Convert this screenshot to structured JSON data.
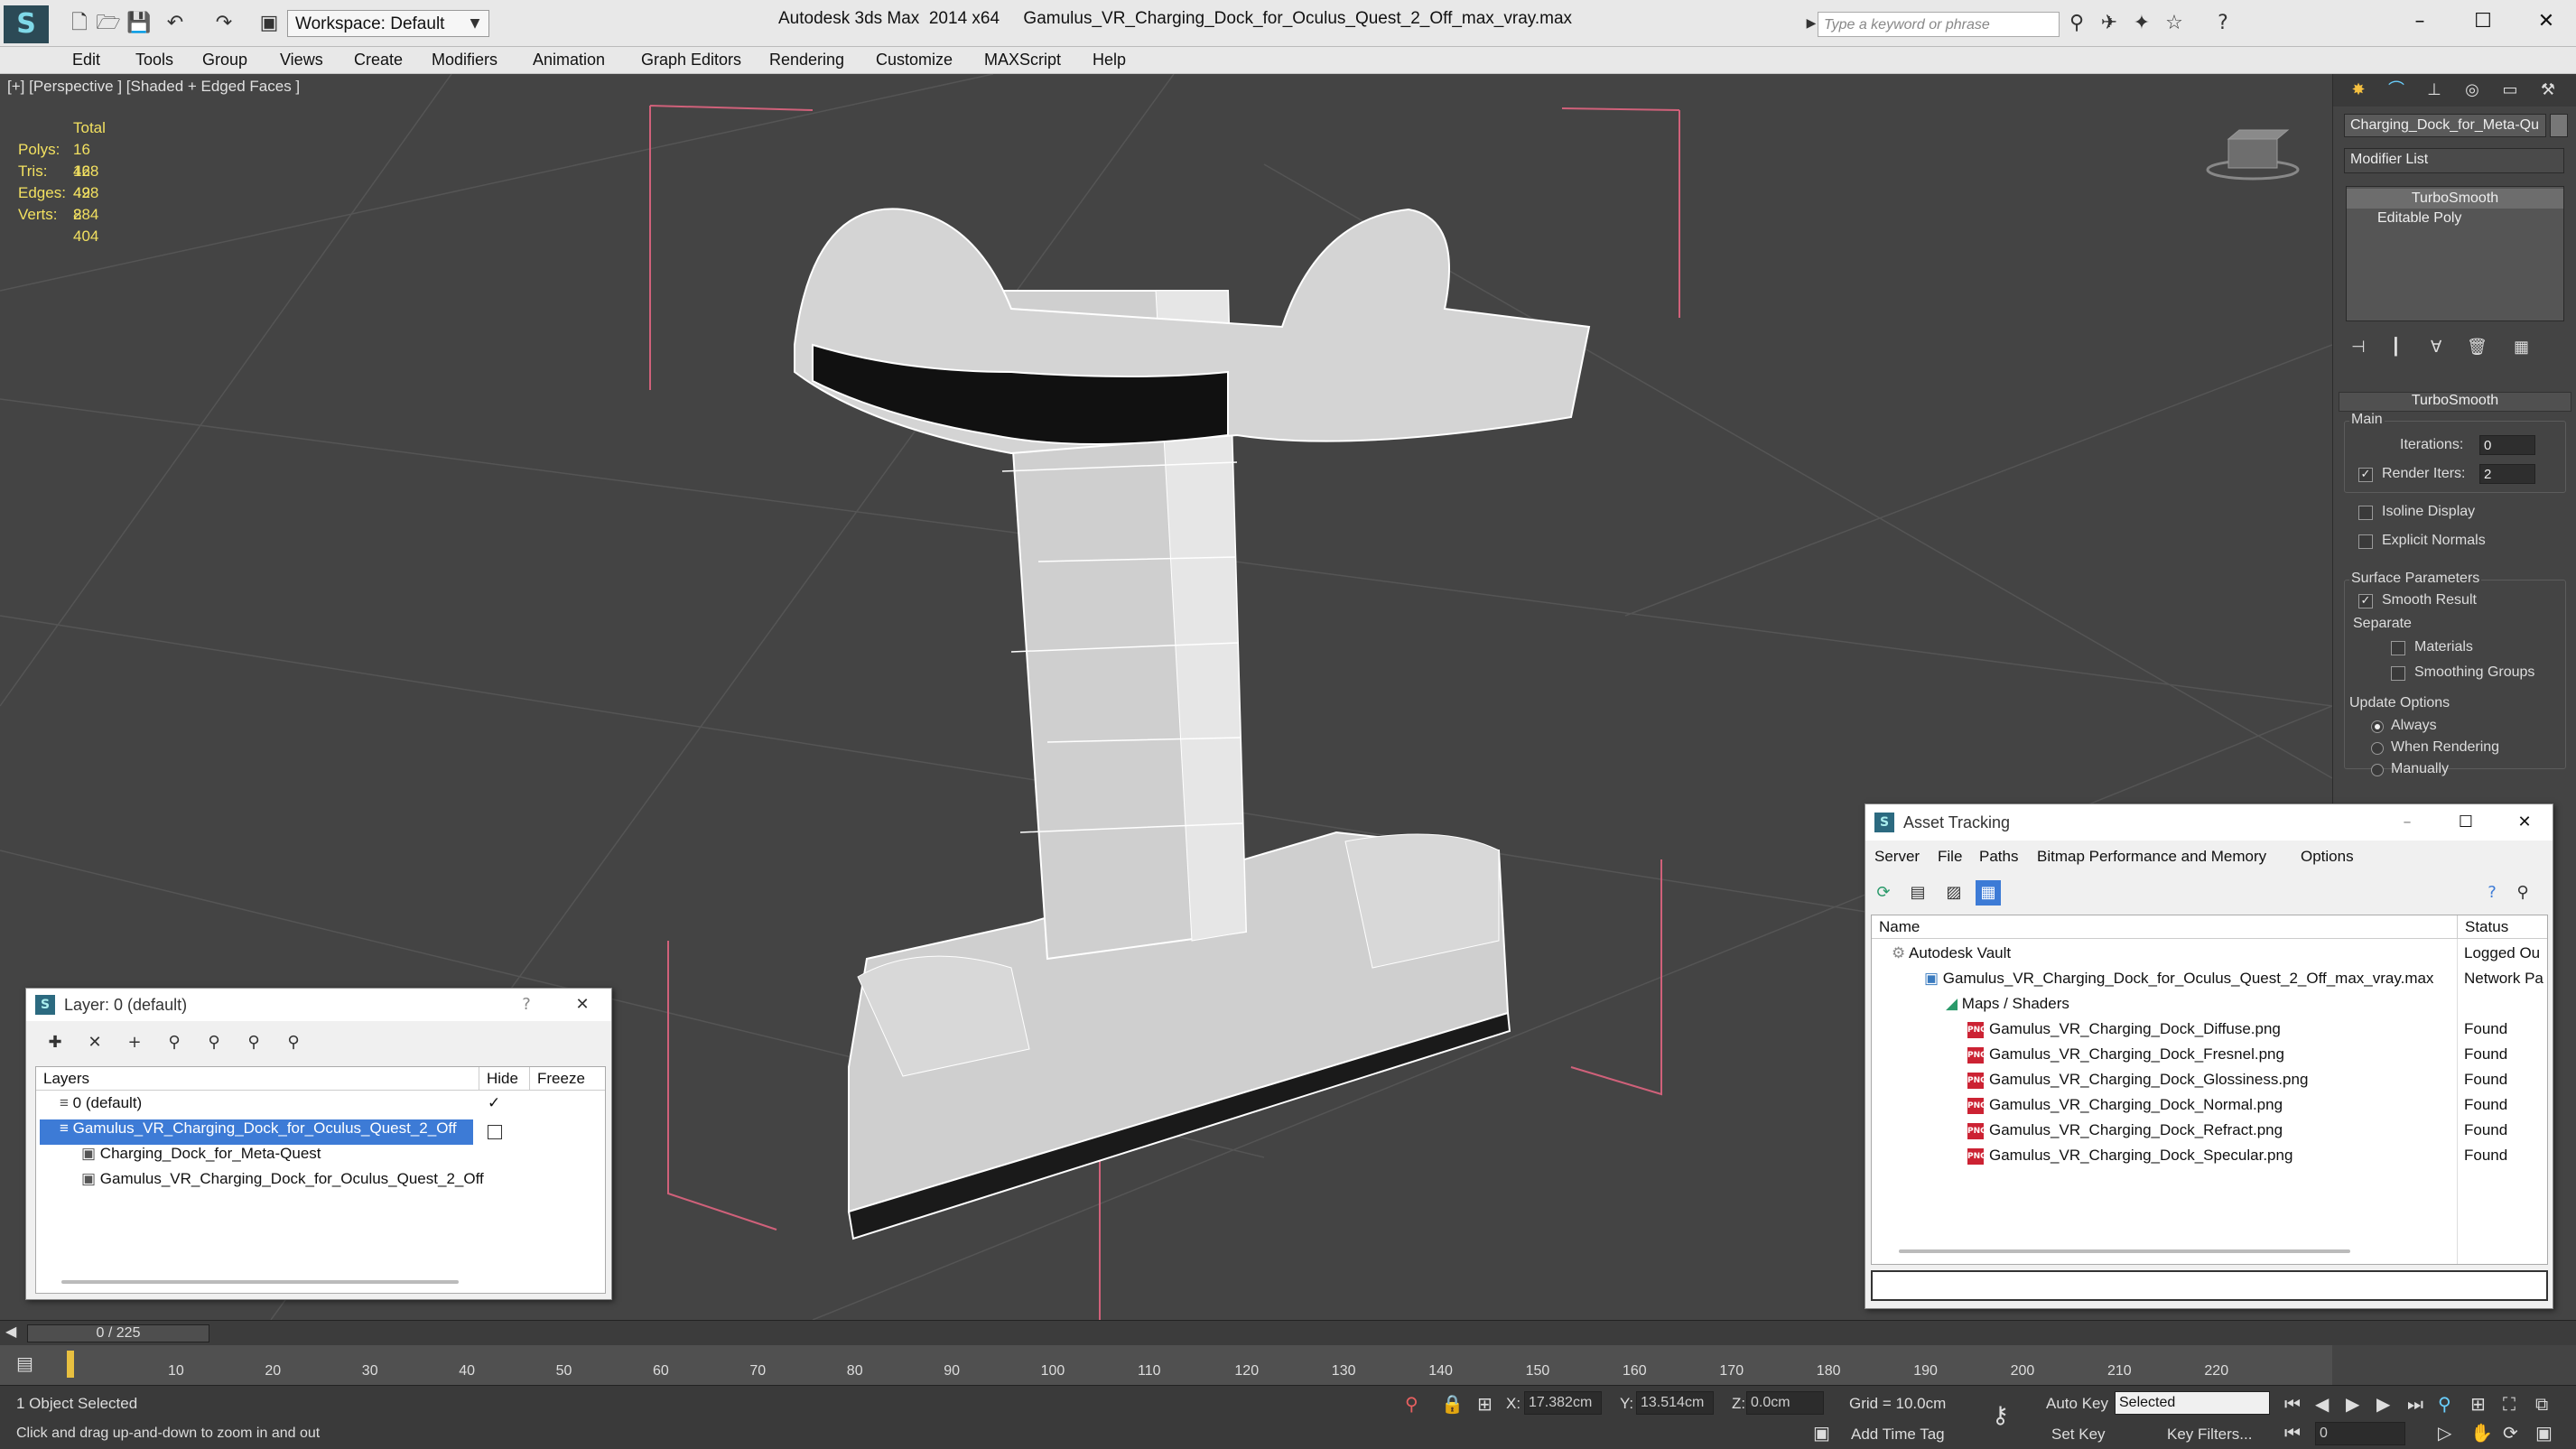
{
  "app": {
    "title": "Autodesk 3ds Max  2014 x64     Gamulus_VR_Charging_Dock_for_Oculus_Quest_2_Off_max_vray.max",
    "workspace": "Workspace: Default",
    "search_placeholder": "Type a keyword or phrase"
  },
  "menu": [
    "Edit",
    "Tools",
    "Group",
    "Views",
    "Create",
    "Modifiers",
    "Animation",
    "Graph Editors",
    "Rendering",
    "Customize",
    "MAXScript",
    "Help"
  ],
  "viewport": {
    "label": "[+] [Perspective ] [Shaded + Edged Faces ]",
    "stats": {
      "header": "Total",
      "rows": [
        {
          "k": "Polys:",
          "v": "16 428"
        },
        {
          "k": "Tris:",
          "v": "16 428"
        },
        {
          "k": "Edges:",
          "v": "49 284"
        },
        {
          "k": "Verts:",
          "v": "8 404"
        }
      ]
    }
  },
  "command_panel": {
    "object_name": "Charging_Dock_for_Meta-Qu",
    "modifier_list": "Modifier List",
    "stack": [
      "TurboSmooth",
      "Editable Poly"
    ],
    "rollout_title": "TurboSmooth",
    "main_label": "Main",
    "iterations_label": "Iterations:",
    "iterations_value": "0",
    "render_iters_label": "Render Iters:",
    "render_iters_value": "2",
    "isoline_display": "Isoline Display",
    "explicit_normals": "Explicit Normals",
    "surface_parameters": "Surface Parameters",
    "smooth_result": "Smooth Result",
    "separate": "Separate",
    "materials": "Materials",
    "smoothing_groups": "Smoothing Groups",
    "update_options": "Update Options",
    "always": "Always",
    "when_rendering": "When Rendering",
    "manually": "Manually"
  },
  "asset_tracking": {
    "title": "Asset Tracking",
    "menu": [
      "Server",
      "File",
      "Paths",
      "Bitmap Performance and Memory",
      "Options"
    ],
    "col_name": "Name",
    "col_status": "Status",
    "rows": [
      {
        "name": "Autodesk Vault",
        "status": "Logged Ou"
      },
      {
        "name": "Gamulus_VR_Charging_Dock_for_Oculus_Quest_2_Off_max_vray.max",
        "status": "Network Pa"
      },
      {
        "name": "Maps / Shaders",
        "status": ""
      },
      {
        "name": "Gamulus_VR_Charging_Dock_Diffuse.png",
        "status": "Found"
      },
      {
        "name": "Gamulus_VR_Charging_Dock_Fresnel.png",
        "status": "Found"
      },
      {
        "name": "Gamulus_VR_Charging_Dock_Glossiness.png",
        "status": "Found"
      },
      {
        "name": "Gamulus_VR_Charging_Dock_Normal.png",
        "status": "Found"
      },
      {
        "name": "Gamulus_VR_Charging_Dock_Refract.png",
        "status": "Found"
      },
      {
        "name": "Gamulus_VR_Charging_Dock_Specular.png",
        "status": "Found"
      }
    ]
  },
  "layer_dialog": {
    "title": "Layer: 0 (default)",
    "help": "?",
    "col_layers": "Layers",
    "col_hide": "Hide",
    "col_freeze": "Freeze",
    "rows": [
      {
        "name": "0 (default)"
      },
      {
        "name": "Gamulus_VR_Charging_Dock_for_Oculus_Quest_2_Off"
      },
      {
        "name": "Charging_Dock_for_Meta-Quest"
      },
      {
        "name": "Gamulus_VR_Charging_Dock_for_Oculus_Quest_2_Off"
      }
    ]
  },
  "timeline": {
    "slider": "0 / 225",
    "ticks": [
      "10",
      "20",
      "30",
      "40",
      "50",
      "60",
      "70",
      "80",
      "90",
      "100",
      "110",
      "120",
      "130",
      "140",
      "150",
      "160",
      "170",
      "180",
      "190",
      "200",
      "210",
      "220"
    ]
  },
  "status": {
    "selection": "1 Object Selected",
    "prompt": "Click and drag up-and-down to zoom in and out",
    "x_label": "X:",
    "x": "17.382cm",
    "y_label": "Y:",
    "y": "13.514cm",
    "z_label": "Z:",
    "z": "0.0cm",
    "grid": "Grid = 10.0cm",
    "add_time_tag": "Add Time Tag",
    "auto_key": "Auto Key",
    "selected": "Selected",
    "set_key": "Set Key",
    "key_filters": "Key Filters...",
    "frame": "0"
  }
}
